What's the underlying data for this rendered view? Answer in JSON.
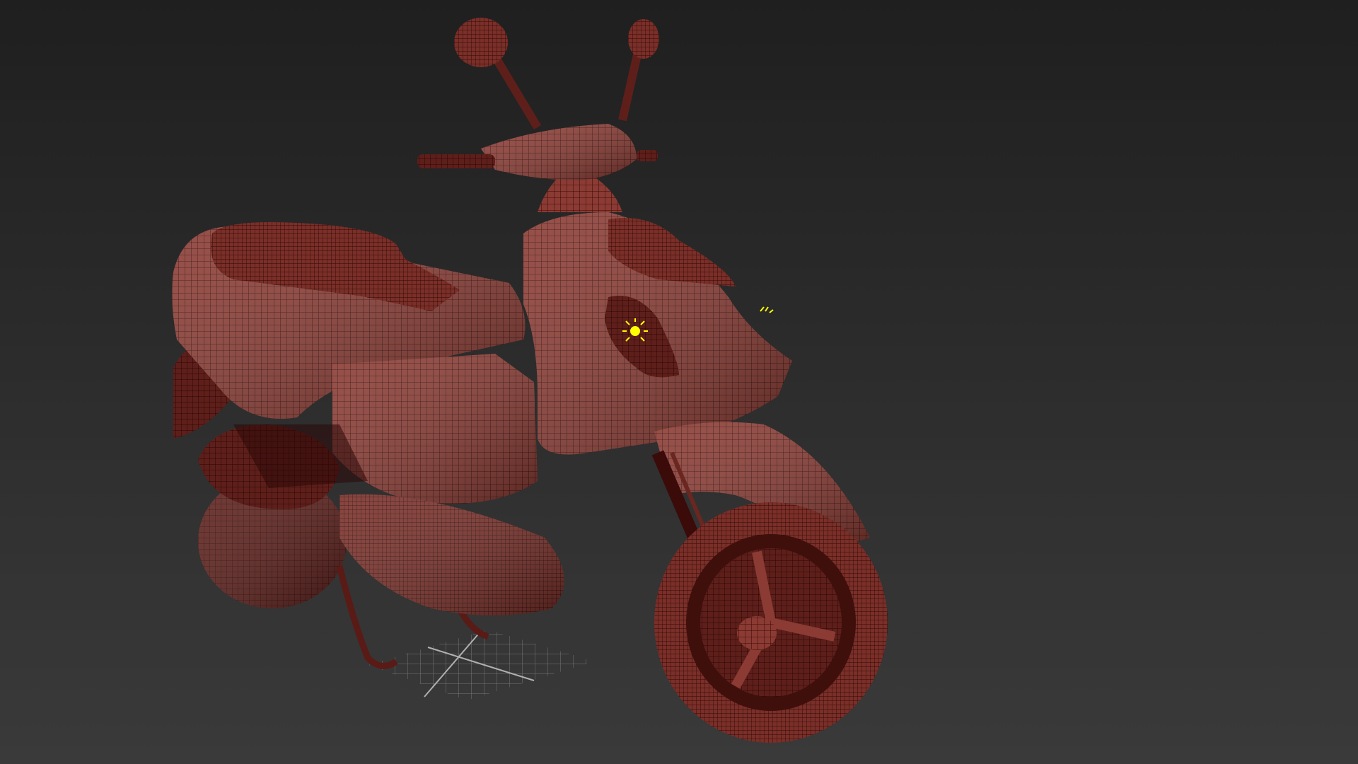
{
  "viewport": {
    "background_top": "#1f1f1f",
    "background_bottom": "#3a3a3a"
  },
  "scene": {
    "object": "scooter-wireframe-mesh",
    "mesh_color": "#8a3a32",
    "mesh_shadow": "#4a1512",
    "wire_color": "#2a0807",
    "light_icon_color": "#ffff00",
    "grid_color": "#9a9a9a"
  }
}
